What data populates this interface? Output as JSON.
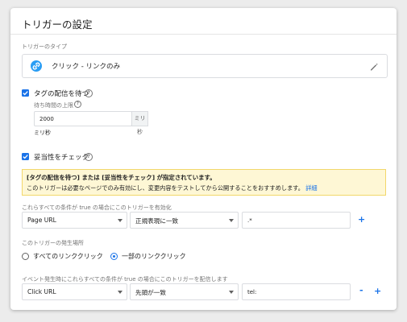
{
  "panel": {
    "title": "トリガーの設定"
  },
  "trigger_type": {
    "label": "トリガーのタイプ",
    "value": "クリック - リンクのみ",
    "icon": "link-icon",
    "edit_icon": "pencil-icon"
  },
  "wait_for_tags": {
    "label": "タグの配信を待つ",
    "checked": true,
    "max_wait_label": "待ち時間の上限",
    "max_wait_value": "2000",
    "unit_suffix": "ミリ秒",
    "unit_below": "ミリ秒"
  },
  "check_validation": {
    "label": "妥当性をチェック",
    "checked": true
  },
  "warning": {
    "title": "[タグの配信を待つ] または [妥当性をチェック] が指定されています。",
    "body": "このトリガーは必要なページでのみ有効にし、変更内容をテストしてから公開することをおすすめします。",
    "link": "詳細"
  },
  "enable_conditions": {
    "label": "これらすべての条件が true の場合にこのトリガーを有効化",
    "variable": "Page URL",
    "operator": "正規表現に一致",
    "value": ".*",
    "add": "+"
  },
  "fires_on": {
    "label": "このトリガーの発生場所",
    "options": [
      "すべてのリンククリック",
      "一部のリンククリック"
    ],
    "selected_index": 1
  },
  "fire_conditions": {
    "label": "イベント発生時にこれらすべての条件が true の場合にこのトリガーを配信します",
    "variable": "Click URL",
    "operator": "先頭が一致",
    "value": "tel:",
    "remove": "-",
    "add": "+"
  },
  "colors": {
    "accent": "#1a73e8",
    "warning_bg": "#fef7d5",
    "warning_border": "#f2d76b"
  }
}
